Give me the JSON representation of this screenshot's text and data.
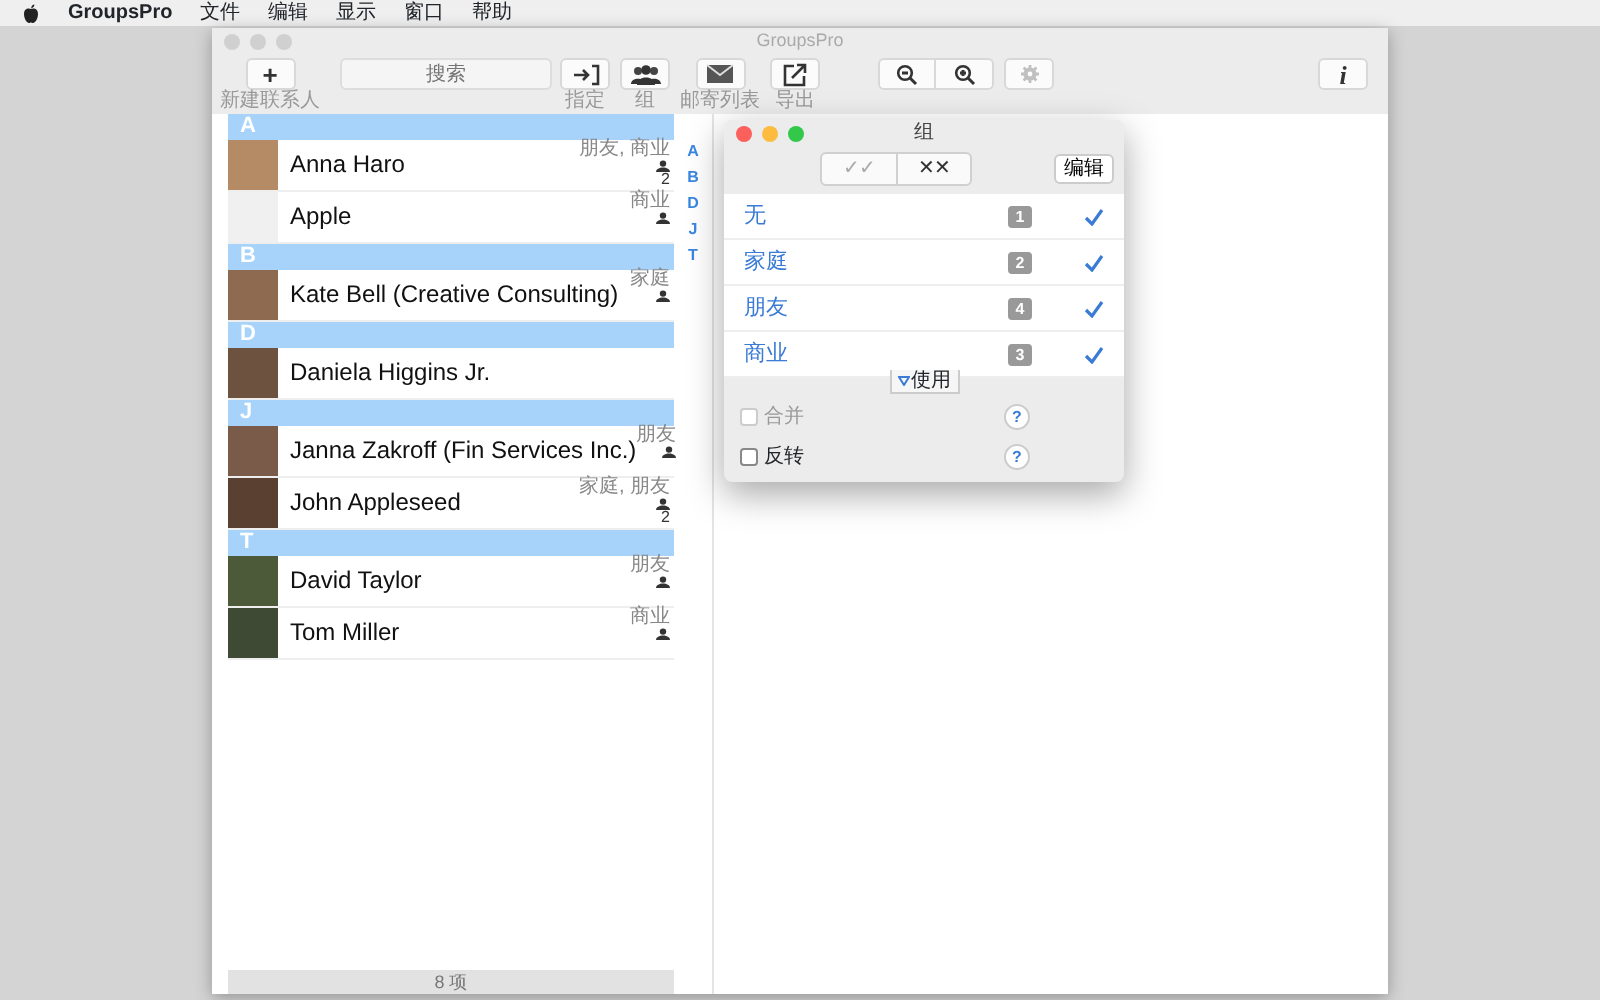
{
  "menu_bar": {
    "app_name": "GroupsPro",
    "menus": [
      "文件",
      "编辑",
      "显示",
      "窗口",
      "帮助"
    ]
  },
  "window": {
    "title": "GroupsPro",
    "active": false,
    "toolbar": [
      {
        "kind": "new",
        "glyph": "+",
        "label": "新建联系人"
      },
      {
        "kind": "search",
        "placeholder": "搜索"
      },
      {
        "kind": "assign",
        "label": "指定"
      },
      {
        "kind": "groups",
        "label": "组"
      },
      {
        "kind": "mail",
        "label": "邮寄列表"
      },
      {
        "kind": "export",
        "label": "导出"
      },
      {
        "kind": "zoom_out"
      },
      {
        "kind": "zoom_in"
      },
      {
        "kind": "settings",
        "disabled": true
      },
      {
        "kind": "info",
        "glyph": "i"
      }
    ],
    "sections": [
      {
        "letter": "A",
        "contacts": [
          {
            "name": "Anna Haro",
            "kind": "person",
            "groups": "朋友, 商业",
            "count": "2"
          },
          {
            "name": "Apple",
            "kind": "company",
            "groups": "商业"
          }
        ]
      },
      {
        "letter": "B",
        "contacts": [
          {
            "name": "Kate Bell (Creative Consulting)",
            "kind": "person",
            "groups": "家庭"
          }
        ]
      },
      {
        "letter": "D",
        "contacts": [
          {
            "name": "Daniela Higgins Jr.",
            "kind": "person"
          }
        ]
      },
      {
        "letter": "J",
        "contacts": [
          {
            "name": "Janna Zakroff (Fin Services Inc.)",
            "kind": "person",
            "groups": "朋友"
          },
          {
            "name": "John Appleseed",
            "kind": "person",
            "groups": "家庭, 朋友",
            "count": "2"
          }
        ]
      },
      {
        "letter": "T",
        "contacts": [
          {
            "name": "David Taylor",
            "kind": "person",
            "groups": "朋友"
          },
          {
            "name": "Tom Miller",
            "kind": "person",
            "groups": "商业"
          }
        ]
      }
    ],
    "index": [
      "A",
      "B",
      "D",
      "J",
      "T"
    ],
    "footer": "8 项"
  },
  "groups_panel": {
    "title": "组",
    "active": true,
    "select_all": {
      "label": "✓✓",
      "disabled": true
    },
    "select_none": {
      "label": "✕✕",
      "disabled": false
    },
    "edit": "编辑",
    "groups": [
      {
        "name": "无",
        "count": "1",
        "checked": true
      },
      {
        "name": "家庭",
        "count": "2",
        "checked": true
      },
      {
        "name": "朋友",
        "count": "4",
        "checked": true
      },
      {
        "name": "商业",
        "count": "3",
        "checked": true
      }
    ],
    "usage_tab": "使用",
    "options": [
      {
        "label": "合并",
        "checked": false,
        "disabled": true,
        "help": "?"
      },
      {
        "label": "反转",
        "checked": false,
        "disabled": false,
        "help": "?"
      }
    ]
  }
}
